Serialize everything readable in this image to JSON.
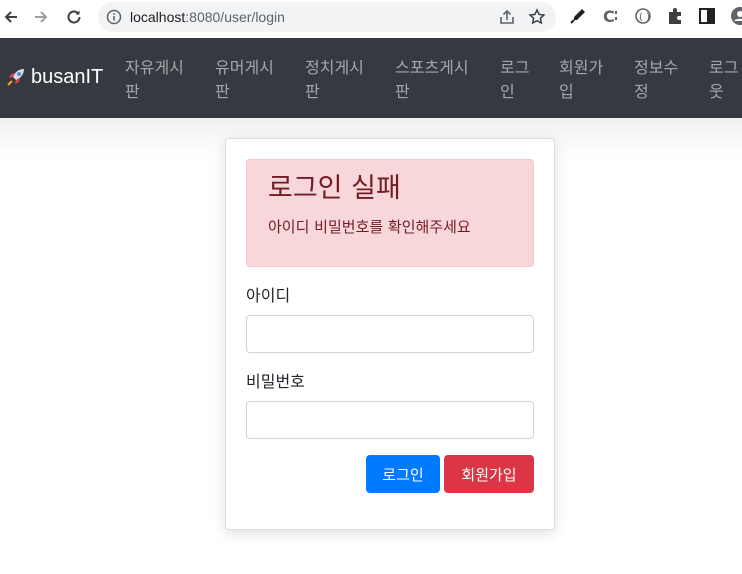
{
  "browser": {
    "url_host": "localhost",
    "url_rest": ":8080/user/login"
  },
  "navbar": {
    "brand": "busanIT",
    "links": [
      {
        "line1": "자유게시",
        "line2": "판"
      },
      {
        "line1": "유머게시",
        "line2": "판"
      },
      {
        "line1": "정치게시",
        "line2": "판"
      },
      {
        "line1": "스포츠게시",
        "line2": "판"
      },
      {
        "line1": "로그",
        "line2": "인"
      },
      {
        "line1": "회원가",
        "line2": "입"
      },
      {
        "line1": "정보수",
        "line2": "정"
      },
      {
        "line1": "로그",
        "line2": "웃"
      }
    ]
  },
  "alert": {
    "heading": "로그인 실패",
    "message": "아이디 비밀번호를 확인해주세요"
  },
  "form": {
    "username_label": "아이디",
    "username_value": "",
    "password_label": "비밀번호",
    "password_value": "",
    "login_button": "로그인",
    "signup_button": "회원가입"
  },
  "colors": {
    "navbar_bg": "#343a40",
    "alert_bg": "#f8d7da",
    "alert_text": "#721c24",
    "primary": "#007bff",
    "danger": "#dc3545"
  }
}
